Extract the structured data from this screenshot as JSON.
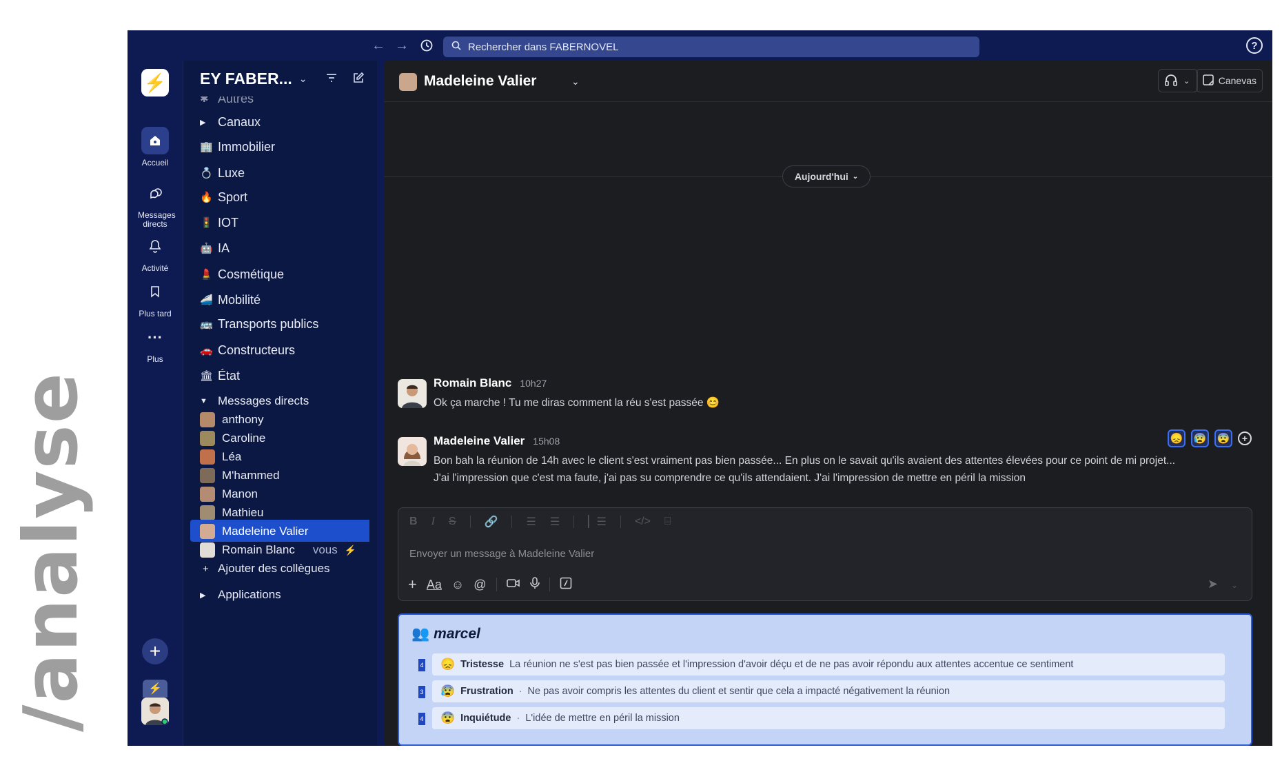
{
  "brand_side": "/analyse",
  "topbar": {
    "back_icon": "arrow-left-icon",
    "forward_icon": "arrow-right-icon",
    "history_icon": "clock-icon",
    "search_placeholder": "Rechercher dans FABERNOVEL",
    "help_icon": "help-icon"
  },
  "rail": {
    "items": [
      {
        "label": "Accueil",
        "icon": "home-icon"
      },
      {
        "label": "Messages directs",
        "icon": "messages-icon"
      },
      {
        "label": "Activité",
        "icon": "bell-icon"
      },
      {
        "label": "Plus tard",
        "icon": "bookmark-icon"
      },
      {
        "label": "Plus",
        "icon": "more-icon"
      }
    ]
  },
  "sidebar": {
    "workspace": "EY FABER...",
    "partial_top": "Autres",
    "channels_header": "Canaux",
    "channels": [
      {
        "label": "Immobilier",
        "emoji": "🏢"
      },
      {
        "label": "Luxe",
        "emoji": "💍"
      },
      {
        "label": "Sport",
        "emoji": "🔥"
      },
      {
        "label": "IOT",
        "emoji": "🚦"
      },
      {
        "label": "IA",
        "emoji": "🤖"
      },
      {
        "label": "Cosmétique",
        "emoji": "💄"
      },
      {
        "label": "Mobilité",
        "emoji": "🚄"
      },
      {
        "label": "Transports publics",
        "emoji": "🚌"
      },
      {
        "label": "Constructeurs",
        "emoji": "🚗"
      },
      {
        "label": "État",
        "emoji": "🏛"
      }
    ],
    "dm_header": "Messages directs",
    "dms": [
      "anthony",
      "Caroline",
      "Léa",
      "M'hammed",
      "Manon",
      "Mathieu",
      "Madeleine Valier",
      "Romain Blanc"
    ],
    "vous": "vous",
    "add_colleagues": "Ajouter des collègues",
    "applications": "Applications"
  },
  "main": {
    "title": "Madeleine Valier",
    "canvas_label": "Canevas",
    "day_pill": "Aujourd'hui",
    "messages": [
      {
        "author": "Romain Blanc",
        "time": "10h27",
        "text": "Ok ça marche ! Tu me diras comment la réu s'est passée 😊"
      },
      {
        "author": "Madeleine Valier",
        "time": "15h08",
        "text_line1": "Bon bah la réunion de 14h avec le client s'est vraiment pas bien passée... En plus on le savait qu'ils avaient des attentes élevées pour ce point de mi projet...",
        "text_line2": "J'ai l'impression que c'est ma faute, j'ai pas su comprendre ce qu'ils attendaient. J'ai l'impression de mettre en péril la mission"
      }
    ],
    "reactions": [
      "😞",
      "😰",
      "😨"
    ],
    "composer_placeholder": "Envoyer un message à Madeleine Valier",
    "format_label": "Aa"
  },
  "marcel": {
    "title": "marcel",
    "rows": [
      {
        "num": "4",
        "emoji": "😞",
        "label": "Tristesse",
        "text": "La réunion ne s'est pas bien passée et l'impression d'avoir déçu et de ne pas avoir répondu aux attentes accentue ce sentiment"
      },
      {
        "num": "3",
        "emoji": "😰",
        "label": "Frustration",
        "text": "Ne pas avoir compris les attentes du client et sentir que cela a impacté négativement la réunion"
      },
      {
        "num": "4",
        "emoji": "😨",
        "label": "Inquiétude",
        "text": "L'idée de mettre en péril la mission"
      }
    ]
  },
  "colors": {
    "window_bg": "#0d1b52",
    "main_bg": "#1b1d21",
    "selected": "#1d4fcc",
    "marcel_bg": "#c4d4f7"
  }
}
